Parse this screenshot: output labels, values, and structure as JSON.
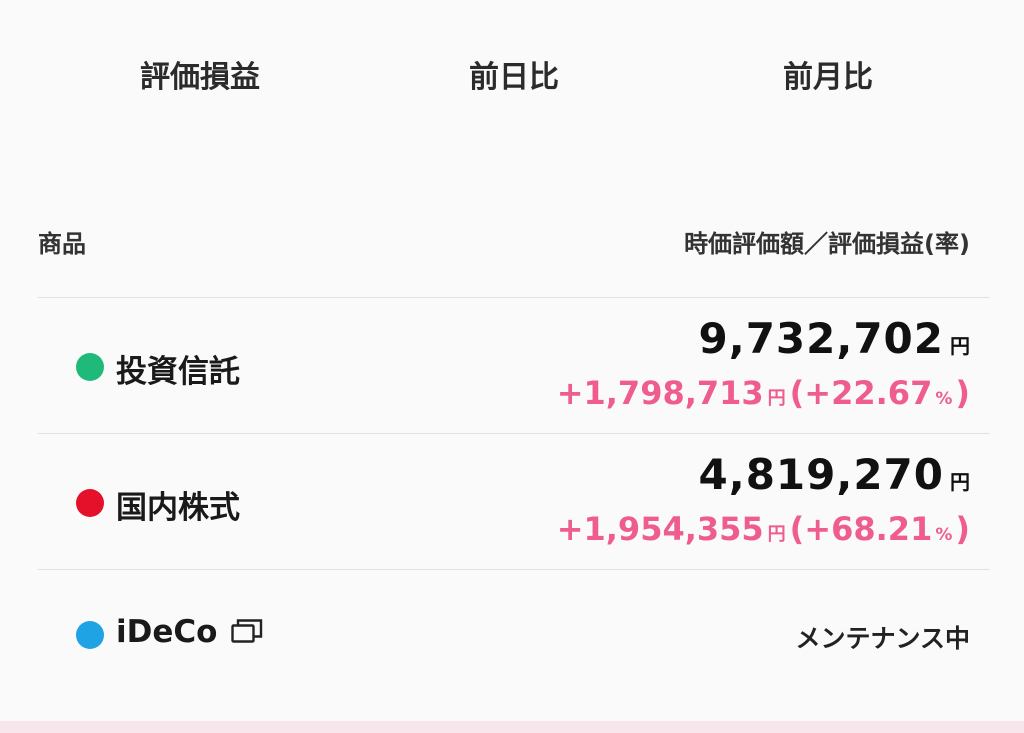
{
  "tabs": [
    {
      "label": "評価損益"
    },
    {
      "label": "前日比"
    },
    {
      "label": "前月比"
    }
  ],
  "table": {
    "header_left": "商品",
    "header_right": "時価評価額／評価損益(率)"
  },
  "rows": [
    {
      "name": "投資信託",
      "dot_color": "#1fba79",
      "value": "9,732,702",
      "value_unit": "円",
      "pl_amount": "+1,798,713",
      "pl_unit": "円",
      "pl_open": "(",
      "pl_rate": "+22.67",
      "pl_percent": "%",
      "pl_close": ")"
    },
    {
      "name": "国内株式",
      "dot_color": "#e5102a",
      "value": "4,819,270",
      "value_unit": "円",
      "pl_amount": "+1,954,355",
      "pl_unit": "円",
      "pl_open": "(",
      "pl_rate": "+68.21",
      "pl_percent": "%",
      "pl_close": ")"
    },
    {
      "name": "iDeCo",
      "dot_color": "#1fa3e4",
      "icon": "external-window-icon",
      "status": "メンテナンス中"
    }
  ],
  "colors": {
    "profit": "#ee5d8e",
    "text": "#1a1a1a",
    "divider": "#e2e2e2"
  }
}
